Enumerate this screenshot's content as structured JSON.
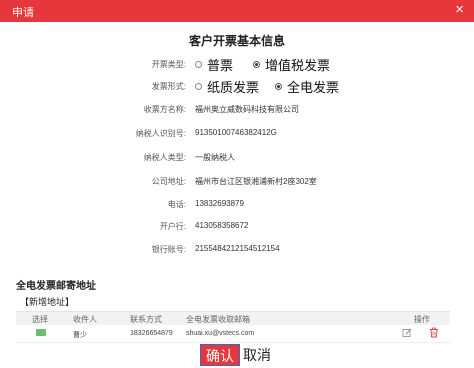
{
  "dialog": {
    "title": "申请",
    "close": "×"
  },
  "section_title": "客户开票基本信息",
  "invoice_type": {
    "label": "开票类型:",
    "options": [
      "普票",
      "增值税发票"
    ],
    "selected_index": 1
  },
  "invoice_form": {
    "label": "发票形式:",
    "options": [
      "纸质发票",
      "全电发票"
    ],
    "selected_index": 1
  },
  "fields": [
    {
      "label": "收票方名称:",
      "value": "福州奥立威数码科技有限公司"
    },
    {
      "label": "纳税人识别号:",
      "value": "91350100746382412G"
    },
    {
      "label": "纳税人类型:",
      "value": "一般纳税人"
    },
    {
      "label": "公司地址:",
      "value": "福州市台江区银湘浦新村2座302室"
    },
    {
      "label": "电话:",
      "value": "13832693879"
    },
    {
      "label": "开户行:",
      "value": "413058358672"
    },
    {
      "label": "银行账号:",
      "value": "2155484212154512154"
    }
  ],
  "mailing": {
    "title": "全电发票邮寄地址",
    "add_link": "【新增地址】",
    "columns": [
      "选择",
      "收件人",
      "联系方式",
      "全电发票收取邮箱",
      "操作"
    ],
    "rows": [
      {
        "recipient": "曹少",
        "phone": "18326654879",
        "email": "shuai.xu@vstecs.com"
      }
    ]
  },
  "footer": {
    "confirm": "确认",
    "cancel": "取消"
  },
  "colors": {
    "accent": "#e8373c",
    "selected_green": "#6cbd6c",
    "focus_border": "#2b6ecc"
  }
}
